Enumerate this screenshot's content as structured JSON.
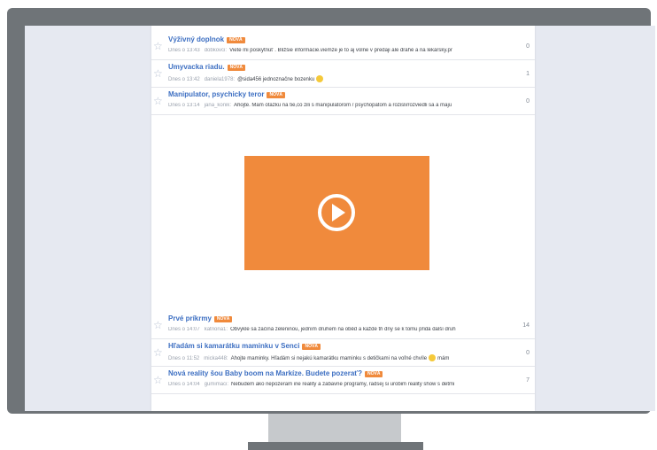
{
  "threads_top": [
    {
      "title": "Výživný doplnok",
      "badge": "NOVÁ",
      "time": "Dnes o 13:43",
      "user": "dobkovci:",
      "snippet": "Viete mi poskytnúť . Bližšie informácie.viemze je to aj volne v predaji ale drahé a na lekársky.pr",
      "count": "0"
    },
    {
      "title": "Umyvacka riadu.",
      "badge": "NOVÁ",
      "time": "Dnes o 13:42",
      "user": "daniela1978:",
      "snippet": "@sida456 jednoznačne bozenku",
      "count": "1"
    },
    {
      "title": "Manipulator, psychicky teror",
      "badge": "NOVÁ",
      "time": "Dnes o 13:14",
      "user": "jana_konik:",
      "snippet": "Ahojte. Mam otazku na tie,co zili s manipulatorom / psychopatom a rozisli/rozviedli sa a maju",
      "count": "0"
    }
  ],
  "threads_bottom": [
    {
      "title": "Prvé príkrmy",
      "badge": "NOVÁ",
      "time": "Dnes o 14:07",
      "user": "katriona1:",
      "snippet": "Obvykle sa začíná zeleninou, jedním druhem na oběd a každé tři dny se k tomu přidá další druh",
      "count": "14"
    },
    {
      "title": "Hľadám si kamarátku maminku v Senci",
      "badge": "NOVÁ",
      "time": "Dnes o 11:52",
      "user": "micka448:",
      "snippet": "Ahojte maminky. Hľadám si nejakú kamarátku maminku s detičkami na voľné chvíle",
      "snippet_after": "mám",
      "count": "0"
    },
    {
      "title": "Nová reality šou Baby boom na Markíze. Budete pozerať?",
      "badge": "NOVÁ",
      "time": "Dnes o 14:04",
      "user": "gumimaci:",
      "snippet": "Nebudem ako nepozeram ine reality a zabavne programy, radsej si urobim reality show s detmi",
      "count": "7"
    }
  ],
  "icons": {
    "star": "star-outline-icon",
    "play": "play-circle-icon",
    "smiley": "smiley-emoji-icon"
  },
  "colors": {
    "accent": "#f08a3c",
    "title_link": "#3d6fc2",
    "frame": "#6f7478"
  }
}
